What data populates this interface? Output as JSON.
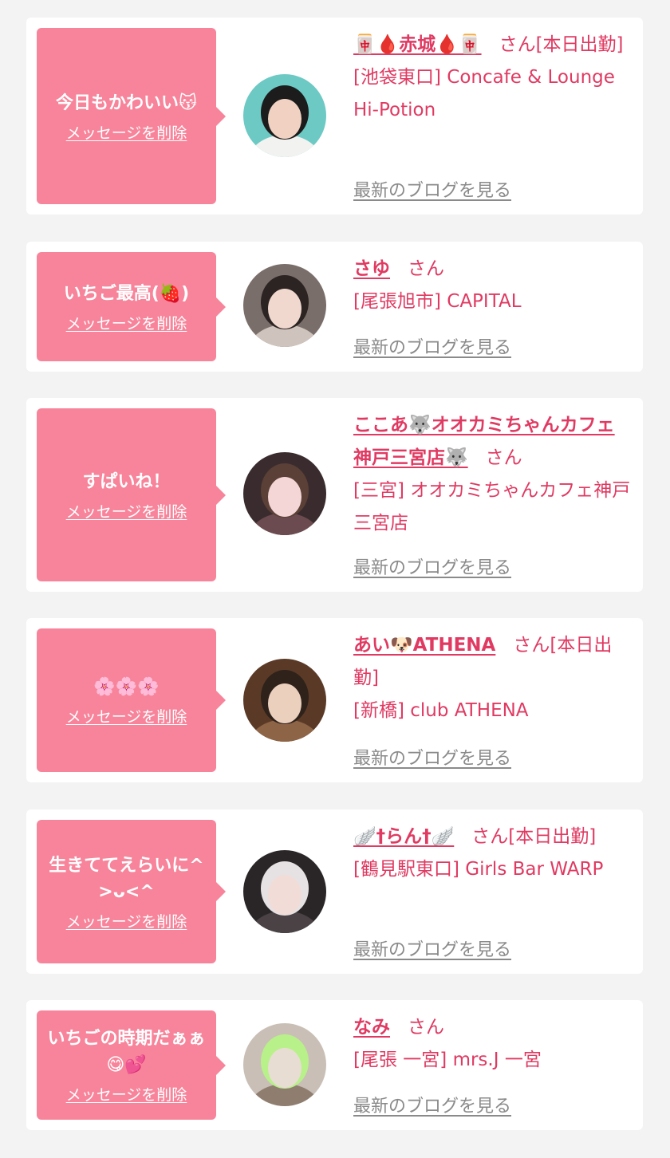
{
  "cards": [
    {
      "message": "今日もかわいい😽",
      "delete_label": "メッセージを削除",
      "name": "🀄🩸赤城🩸🀄",
      "honorific": "さん",
      "status": "[本日出勤]",
      "shop": "[池袋東口] Concafe & Lounge Hi-Potion",
      "blog_label": "最新のブログを見る",
      "avatar_palette": [
        "#6cc9c4",
        "#f2f2f0",
        "#1c1c1c",
        "#f1d2c2"
      ]
    },
    {
      "message": "いちご最高(🍓)",
      "delete_label": "メッセージを削除",
      "name": "さゆ",
      "honorific": "さん",
      "status": "",
      "shop": "[尾張旭市] CAPITAL",
      "blog_label": "最新のブログを見る",
      "avatar_palette": [
        "#7a6e6a",
        "#cfc3bd",
        "#2c2422",
        "#f0d8cf"
      ]
    },
    {
      "message": "すぱいね！",
      "delete_label": "メッセージを削除",
      "name": "ここあ🐺オオカミちゃんカフェ神戸三宮店🐺",
      "honorific": "さん",
      "status": "",
      "shop": "[三宮] オオカミちゃんカフェ神戸三宮店",
      "blog_label": "最新のブログを見る",
      "avatar_palette": [
        "#3a2b2e",
        "#6b4b4f",
        "#5a4036",
        "#f4d6d6"
      ]
    },
    {
      "message": "🌸🌸🌸",
      "delete_label": "メッセージを削除",
      "name": "あい🐶ATHENA",
      "honorific": "さん",
      "status": "[本日出勤]",
      "shop": "[新橋] club ATHENA",
      "blog_label": "最新のブログを見る",
      "avatar_palette": [
        "#5a3a26",
        "#8d6446",
        "#2f221b",
        "#ead0bd"
      ]
    },
    {
      "message": "生きててえらいに^>ᴗ<^",
      "delete_label": "メッセージを削除",
      "name": "🪽†らん†🪽",
      "honorific": "さん",
      "status": "[本日出勤]",
      "shop": "[鶴見駅東口] Girls Bar WARP",
      "blog_label": "最新のブログを見る",
      "avatar_palette": [
        "#2a2627",
        "#4a4244",
        "#e6e2e4",
        "#f1dcd8"
      ]
    },
    {
      "message": "いちごの時期だぁぁ😋💕",
      "delete_label": "メッセージを削除",
      "name": "なみ",
      "honorific": "さん",
      "status": "",
      "shop": "[尾張 一宮] mrs.J 一宮",
      "blog_label": "最新のブログを見る",
      "avatar_palette": [
        "#c9bfb6",
        "#8f7e6f",
        "#b8f08a",
        "#e8ddd3"
      ]
    }
  ]
}
